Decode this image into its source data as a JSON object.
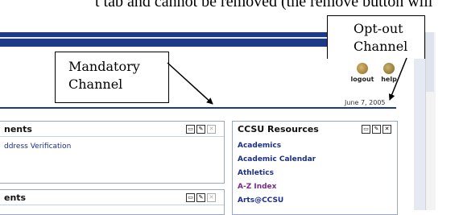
{
  "doc": {
    "text": "t tab and cannot be removed (the remove button will"
  },
  "toolbar": {
    "logout": "logout",
    "help": "help"
  },
  "date": "June 7, 2005",
  "channels": {
    "left_top": {
      "title": "nents",
      "link": "ddress Verification"
    },
    "left_bottom": {
      "title": "ents"
    },
    "resources": {
      "title": "CCSU Resources",
      "items": [
        "Academics",
        "Academic Calendar",
        "Athletics",
        "A-Z Index",
        "Arts@CCSU"
      ]
    }
  },
  "callouts": {
    "mandatory": "Mandatory Channel",
    "optout": "Opt-out Channel"
  },
  "colors": {
    "header_blue": "#1c3a87",
    "link_blue": "#1b2e8c",
    "visited_purple": "#7a2b8a"
  }
}
